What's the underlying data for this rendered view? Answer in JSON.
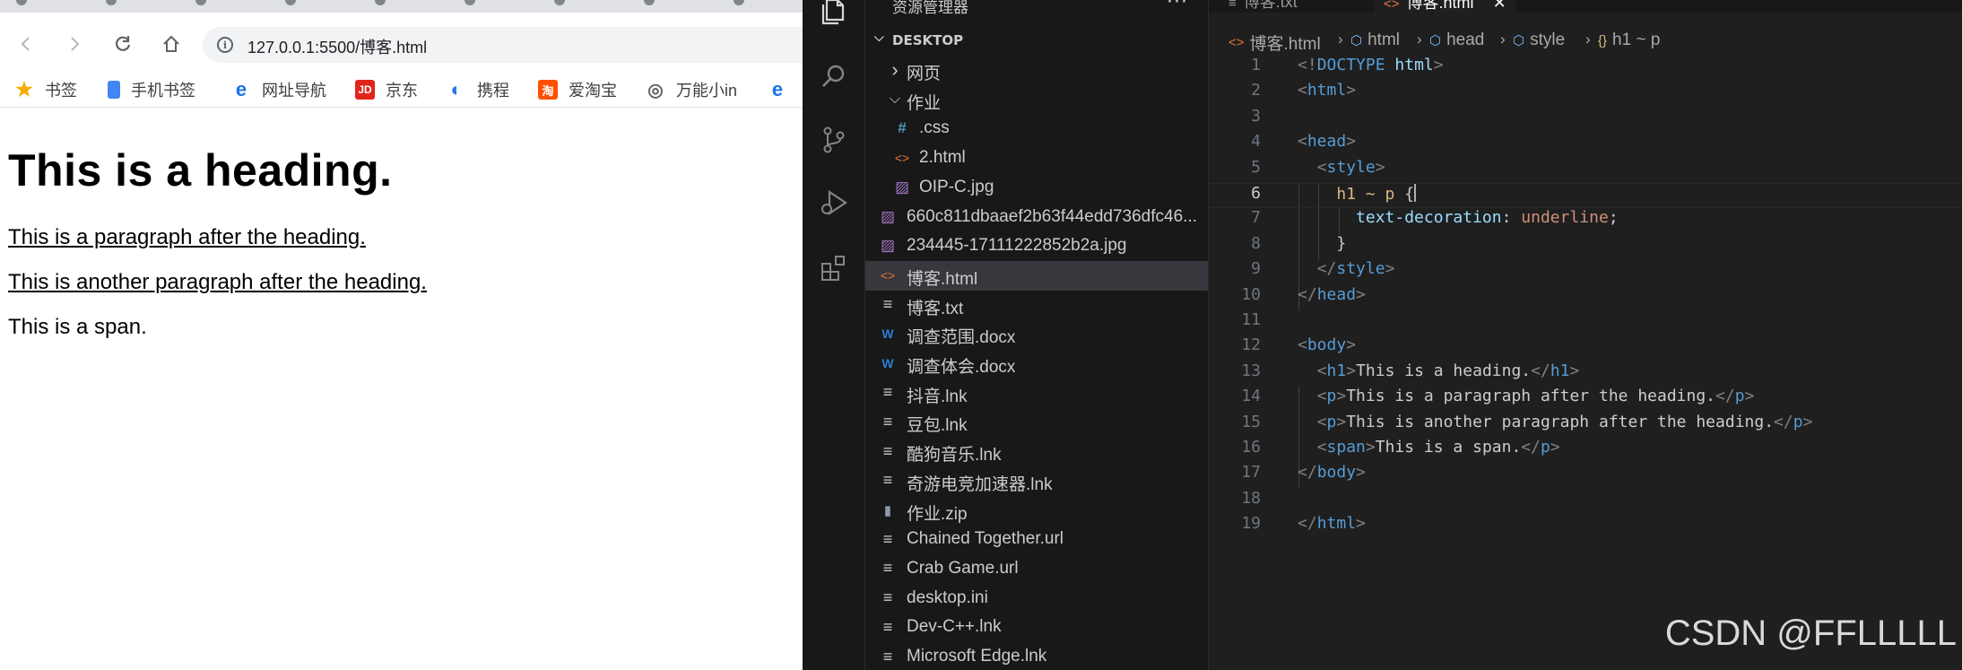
{
  "browser": {
    "url": "127.0.0.1:5500/博客.html",
    "bookmarks": [
      {
        "label": "书签",
        "icon": "star-icon",
        "color": "#f9ab00"
      },
      {
        "label": "手机书签",
        "icon": "phone-bookmark-icon",
        "color": "#4285f4"
      },
      {
        "label": "网址导航",
        "icon": "edge-e-icon",
        "color": "#1a73e8"
      },
      {
        "label": "京东",
        "icon": "jd-icon",
        "color": "#e1251b"
      },
      {
        "label": "携程",
        "icon": "ctrip-icon",
        "color": "#2577e3"
      },
      {
        "label": "爱淘宝",
        "icon": "taobao-icon",
        "color": "#ff5000"
      },
      {
        "label": "万能小in",
        "icon": "wanneng-icon",
        "color": "#5f6368"
      }
    ],
    "page": {
      "heading": "This is a heading.",
      "paragraph1": "This is a paragraph after the heading.",
      "paragraph2": "This is another paragraph after the heading.",
      "span": "This is a span."
    }
  },
  "vscode": {
    "explorer_title": "资源管理器",
    "section": "DESKTOP",
    "tabs": [
      {
        "label": "博客.txt"
      },
      {
        "label": "博客.html",
        "active": true
      }
    ],
    "breadcrumb": [
      "博客.html",
      "html",
      "head",
      "style",
      "h1 ~ p"
    ],
    "tree": [
      {
        "label": "网页",
        "kind": "folder-collapsed",
        "depth": 1
      },
      {
        "label": "作业",
        "kind": "folder-expanded",
        "depth": 1
      },
      {
        "label": ".css",
        "kind": "css",
        "depth": 2
      },
      {
        "label": "2.html",
        "kind": "html",
        "depth": 2
      },
      {
        "label": "OIP-C.jpg",
        "kind": "image",
        "depth": 2
      },
      {
        "label": "660c811dbaaef2b63f44edd736dfc46...",
        "kind": "image",
        "depth": 1
      },
      {
        "label": "234445-17111222852b2a.jpg",
        "kind": "image",
        "depth": 1
      },
      {
        "label": "博客.html",
        "kind": "html",
        "depth": 1,
        "selected": true
      },
      {
        "label": "博客.txt",
        "kind": "text",
        "depth": 1
      },
      {
        "label": "调查范围.docx",
        "kind": "word",
        "depth": 1
      },
      {
        "label": "调查体会.docx",
        "kind": "word",
        "depth": 1
      },
      {
        "label": "抖音.lnk",
        "kind": "text",
        "depth": 1
      },
      {
        "label": "豆包.lnk",
        "kind": "text",
        "depth": 1
      },
      {
        "label": "酷狗音乐.lnk",
        "kind": "text",
        "depth": 1
      },
      {
        "label": "奇游电竞加速器.lnk",
        "kind": "text",
        "depth": 1
      },
      {
        "label": "作业.zip",
        "kind": "zip",
        "depth": 1
      },
      {
        "label": "Chained Together.url",
        "kind": "text",
        "depth": 1
      },
      {
        "label": "Crab Game.url",
        "kind": "text",
        "depth": 1
      },
      {
        "label": "desktop.ini",
        "kind": "text",
        "depth": 1
      },
      {
        "label": "Dev-C++.lnk",
        "kind": "text",
        "depth": 1
      },
      {
        "label": "Microsoft Edge.lnk",
        "kind": "text",
        "depth": 1
      }
    ],
    "code": [
      {
        "n": "1",
        "parts": [
          [
            "punc",
            "<!"
          ],
          [
            "tag",
            "DOCTYPE"
          ],
          [
            "txt",
            " "
          ],
          [
            "prop",
            "html"
          ],
          [
            "punc",
            ">"
          ]
        ]
      },
      {
        "n": "2",
        "parts": [
          [
            "punc",
            "<"
          ],
          [
            "tag",
            "html"
          ],
          [
            "punc",
            ">"
          ]
        ]
      },
      {
        "n": "3",
        "parts": []
      },
      {
        "n": "4",
        "parts": [
          [
            "punc",
            "<"
          ],
          [
            "tag",
            "head"
          ],
          [
            "punc",
            ">"
          ]
        ]
      },
      {
        "n": "5",
        "parts": [
          [
            "txt",
            "  "
          ],
          [
            "punc",
            "<"
          ],
          [
            "tag",
            "style"
          ],
          [
            "punc",
            ">"
          ]
        ]
      },
      {
        "n": "6",
        "current": true,
        "parts": [
          [
            "txt",
            "    "
          ],
          [
            "sel-c",
            "h1 ~ p"
          ],
          [
            "txt",
            " {"
          ]
        ]
      },
      {
        "n": "7",
        "parts": [
          [
            "txt",
            "      "
          ],
          [
            "prop",
            "text-decoration"
          ],
          [
            "txt",
            ": "
          ],
          [
            "val",
            "underline"
          ],
          [
            "txt",
            ";"
          ]
        ]
      },
      {
        "n": "8",
        "parts": [
          [
            "txt",
            "    }"
          ]
        ]
      },
      {
        "n": "9",
        "parts": [
          [
            "txt",
            "  "
          ],
          [
            "punc",
            "</"
          ],
          [
            "tag",
            "style"
          ],
          [
            "punc",
            ">"
          ]
        ]
      },
      {
        "n": "10",
        "parts": [
          [
            "punc",
            "</"
          ],
          [
            "tag",
            "head"
          ],
          [
            "punc",
            ">"
          ]
        ]
      },
      {
        "n": "11",
        "parts": []
      },
      {
        "n": "12",
        "parts": [
          [
            "punc",
            "<"
          ],
          [
            "tag",
            "body"
          ],
          [
            "punc",
            ">"
          ]
        ]
      },
      {
        "n": "13",
        "parts": [
          [
            "txt",
            "  "
          ],
          [
            "punc",
            "<"
          ],
          [
            "tag",
            "h1"
          ],
          [
            "punc",
            ">"
          ],
          [
            "txt",
            "This is a heading."
          ],
          [
            "punc",
            "</"
          ],
          [
            "tag",
            "h1"
          ],
          [
            "punc",
            ">"
          ]
        ]
      },
      {
        "n": "14",
        "parts": [
          [
            "txt",
            "  "
          ],
          [
            "punc",
            "<"
          ],
          [
            "tag",
            "p"
          ],
          [
            "punc",
            ">"
          ],
          [
            "txt",
            "This is a paragraph after the heading."
          ],
          [
            "punc",
            "</"
          ],
          [
            "tag",
            "p"
          ],
          [
            "punc",
            ">"
          ]
        ]
      },
      {
        "n": "15",
        "parts": [
          [
            "txt",
            "  "
          ],
          [
            "punc",
            "<"
          ],
          [
            "tag",
            "p"
          ],
          [
            "punc",
            ">"
          ],
          [
            "txt",
            "This is another paragraph after the heading."
          ],
          [
            "punc",
            "</"
          ],
          [
            "tag",
            "p"
          ],
          [
            "punc",
            ">"
          ]
        ]
      },
      {
        "n": "16",
        "parts": [
          [
            "txt",
            "  "
          ],
          [
            "punc",
            "<"
          ],
          [
            "tag",
            "span"
          ],
          [
            "punc",
            ">"
          ],
          [
            "txt",
            "This is a span."
          ],
          [
            "punc",
            "</"
          ],
          [
            "tag",
            "p"
          ],
          [
            "punc",
            ">"
          ]
        ]
      },
      {
        "n": "17",
        "parts": [
          [
            "punc",
            "</"
          ],
          [
            "tag",
            "body"
          ],
          [
            "punc",
            ">"
          ]
        ]
      },
      {
        "n": "18",
        "parts": []
      },
      {
        "n": "19",
        "parts": [
          [
            "punc",
            "</"
          ],
          [
            "tag",
            "html"
          ],
          [
            "punc",
            ">"
          ]
        ]
      }
    ]
  },
  "watermark": "CSDN @FFLLLLL"
}
